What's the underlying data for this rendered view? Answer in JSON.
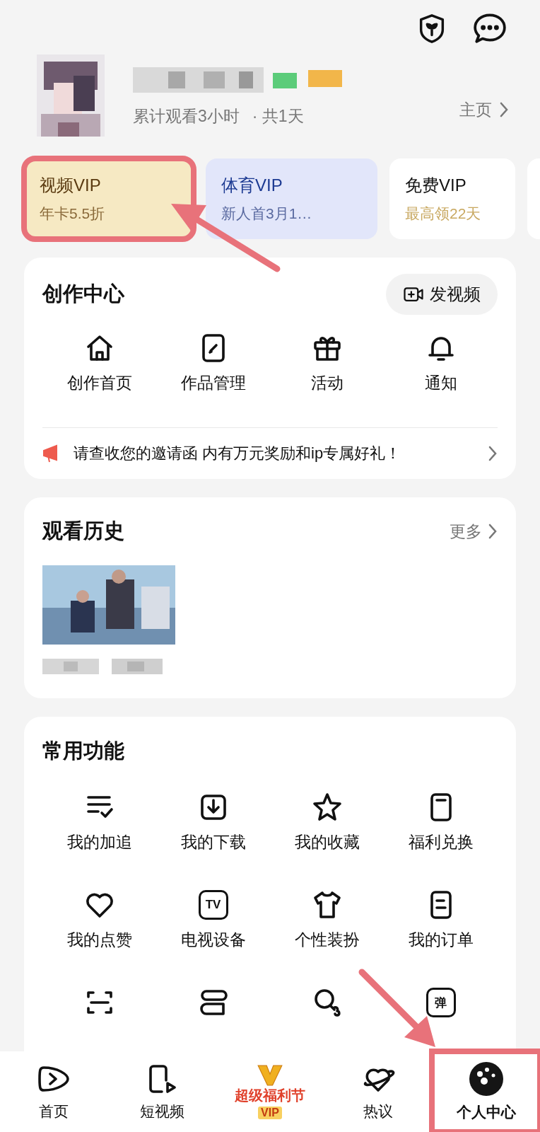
{
  "profile": {
    "stats": "累计观看3小时",
    "days": "· 共1天",
    "home_link": "主页"
  },
  "vip_cards": [
    {
      "title": "视频VIP",
      "subtitle": "年卡5.5折",
      "kind": "gold",
      "highlighted": true
    },
    {
      "title": "体育VIP",
      "subtitle": "新人首3月1…",
      "kind": "blue"
    },
    {
      "title": "免费VIP",
      "subtitle": "最高领22天",
      "kind": "plain"
    }
  ],
  "creation": {
    "title": "创作中心",
    "post_button": "发视频",
    "items": [
      {
        "label": "创作首页"
      },
      {
        "label": "作品管理"
      },
      {
        "label": "活动"
      },
      {
        "label": "通知"
      }
    ],
    "notice": "请查收您的邀请函 内有万元奖励和ip专属好礼！"
  },
  "history": {
    "title": "观看历史",
    "more": "更多"
  },
  "functions": {
    "title": "常用功能",
    "items": [
      {
        "label": "我的加追"
      },
      {
        "label": "我的下载"
      },
      {
        "label": "我的收藏"
      },
      {
        "label": "福利兑换"
      },
      {
        "label": "我的点赞"
      },
      {
        "label": "电视设备",
        "badge": "TV"
      },
      {
        "label": "个性装扮"
      },
      {
        "label": "我的订单"
      },
      {
        "kind": "icon"
      },
      {
        "kind": "icon"
      },
      {
        "kind": "icon"
      },
      {
        "kind": "icon",
        "badge": "弹"
      }
    ]
  },
  "nav": [
    {
      "kind": "tab",
      "label": "首页",
      "selected": false
    },
    {
      "kind": "tab",
      "label": "短视频",
      "selected": false
    },
    {
      "kind": "promo",
      "title": "超级福利节",
      "badge": "VIP"
    },
    {
      "kind": "tab",
      "label": "热议",
      "selected": false
    },
    {
      "kind": "tab",
      "label": "个人中心",
      "selected": true,
      "highlighted": true
    }
  ]
}
